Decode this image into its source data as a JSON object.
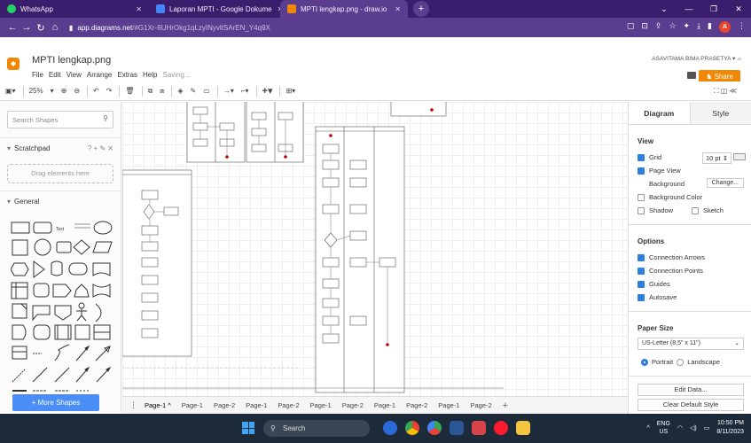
{
  "browser": {
    "tabs": [
      {
        "title": "WhatsApp",
        "color": "#25d366"
      },
      {
        "title": "Laporan MPTI - Google Dokume",
        "color": "#4285f4"
      },
      {
        "title": "MPTI lengkap.png - draw.io",
        "color": "#f08705"
      }
    ],
    "url_host": "app.diagrams.net",
    "url_path": "/#G1Xr-6UHrOkg1qLzyINyvltSArEN_Y4q9X",
    "profile_initial": "A"
  },
  "app": {
    "title": "MPTI lengkap.png",
    "menu": [
      "File",
      "Edit",
      "View",
      "Arrange",
      "Extras",
      "Help"
    ],
    "saving": "Saving...",
    "user": "ASAVITAMA BIMA PRASETYA",
    "share": "Share",
    "zoom": "25%"
  },
  "sidebar": {
    "search_placeholder": "Search Shapes",
    "scratchpad": "Scratchpad",
    "scratchpad_tools": "? + ✎ ✕",
    "drag_here": "Drag elements here",
    "general": "General",
    "more_shapes": "+ More Shapes"
  },
  "pages": [
    "Page-1",
    "Page-1",
    "Page-2",
    "Page-1",
    "Page-2",
    "Page-1",
    "Page-2",
    "Page-1",
    "Page-2",
    "Page-1",
    "Page-2"
  ],
  "panel": {
    "tab_diagram": "Diagram",
    "tab_style": "Style",
    "view_title": "View",
    "grid": "Grid",
    "grid_size": "10 pt",
    "page_view": "Page View",
    "background": "Background",
    "change": "Change...",
    "background_color": "Background Color",
    "shadow": "Shadow",
    "sketch": "Sketch",
    "options_title": "Options",
    "connection_arrows": "Connection Arrows",
    "connection_points": "Connection Points",
    "guides": "Guides",
    "autosave": "Autosave",
    "paper_size_title": "Paper Size",
    "paper_size": "US-Letter (8,5\" x 11\")",
    "portrait": "Portrait",
    "landscape": "Landscape",
    "edit_data": "Edit Data...",
    "clear_default_style": "Clear Default Style"
  },
  "taskbar": {
    "search": "Search",
    "lang": "ENG",
    "region": "US",
    "time": "10:50 PM",
    "date": "8/11/2023"
  }
}
